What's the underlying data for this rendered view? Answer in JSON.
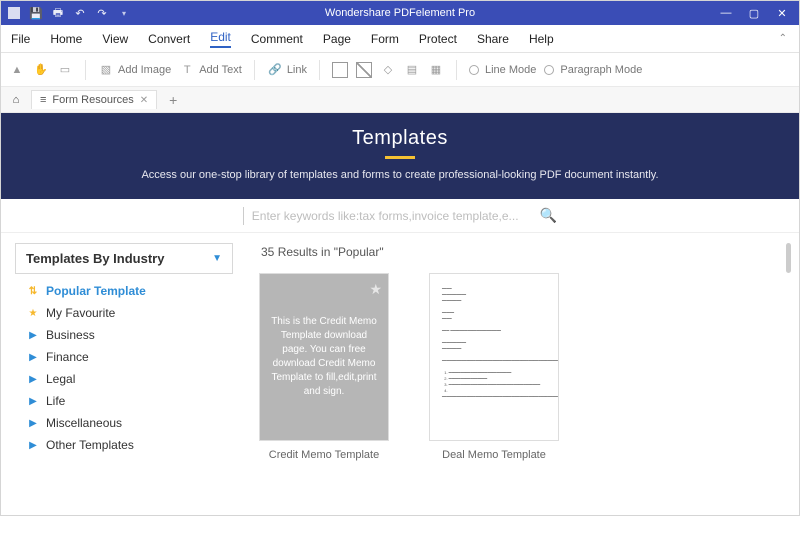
{
  "titlebar": {
    "title": "Wondershare PDFelement Pro"
  },
  "menu": {
    "items": [
      "File",
      "Home",
      "View",
      "Convert",
      "Edit",
      "Comment",
      "Page",
      "Form",
      "Protect",
      "Share",
      "Help"
    ],
    "active": 4
  },
  "toolbar": {
    "add_image": "Add Image",
    "add_text": "Add Text",
    "link": "Link",
    "line_mode": "Line Mode",
    "paragraph_mode": "Paragraph Mode"
  },
  "tabs": {
    "open": [
      {
        "icon": "≡",
        "label": "Form Resources"
      }
    ]
  },
  "banner": {
    "title": "Templates",
    "subtitle": "Access our one-stop library of templates and forms to create professional-looking PDF document instantly."
  },
  "search": {
    "placeholder": "Enter keywords like:tax forms,invoice template,e..."
  },
  "sidebar": {
    "heading": "Templates By Industry",
    "cats": [
      {
        "label": "Popular Template",
        "icon": "pop",
        "active": true
      },
      {
        "label": "My Favourite",
        "icon": "star"
      },
      {
        "label": "Business",
        "icon": "tri"
      },
      {
        "label": "Finance",
        "icon": "tri"
      },
      {
        "label": "Legal",
        "icon": "tri"
      },
      {
        "label": "Life",
        "icon": "tri"
      },
      {
        "label": "Miscellaneous",
        "icon": "tri"
      },
      {
        "label": "Other Templates",
        "icon": "tri"
      }
    ]
  },
  "results": {
    "count": "35",
    "label": " Results in \"Popular\"",
    "items": [
      {
        "caption": "Credit Memo Template",
        "preview_text": "This is the Credit Memo Template download page. You can free download Credit Memo Template to fill,edit,print and sign.",
        "grey": true
      },
      {
        "caption": "Deal Memo Template",
        "grey": false
      }
    ]
  }
}
